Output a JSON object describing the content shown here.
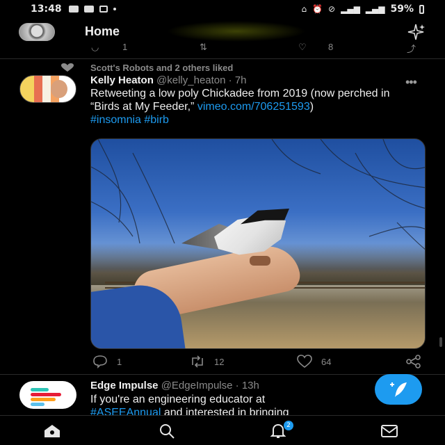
{
  "status_bar": {
    "time": "13:48",
    "battery": "59%"
  },
  "header": {
    "title": "Home"
  },
  "prev_tweet_actions": {
    "reply_count": "1",
    "like_count": "8"
  },
  "tweet": {
    "social_context": "Scott's Robots and 2 others liked",
    "author_name": "Kelly Heaton",
    "author_handle": "@kelly_heaton",
    "time": "· 7h",
    "text_before_link": "Retweeting a low poly Chickadee from 2019 (now perched in “Birds at My Feeder,” ",
    "link": "vimeo.com/706251593",
    "text_after_link": ")",
    "hashtags": "#insomnia #birb",
    "reply_count": "1",
    "retweet_count": "12",
    "like_count": "64"
  },
  "tweet2": {
    "author_name": "Edge Impulse",
    "author_handle": "@EdgeImpulse",
    "time": "· 13h",
    "text_line1": "If you're an engineering educator at",
    "hashtag": "#ASEEAnnual",
    "text_line2_rest": " and interested in bringing"
  },
  "bottom_nav": {
    "notification_badge": "2"
  },
  "colors": {
    "accent": "#1d9bf0",
    "background": "#000000",
    "secondary_text": "#8a8a8a"
  }
}
